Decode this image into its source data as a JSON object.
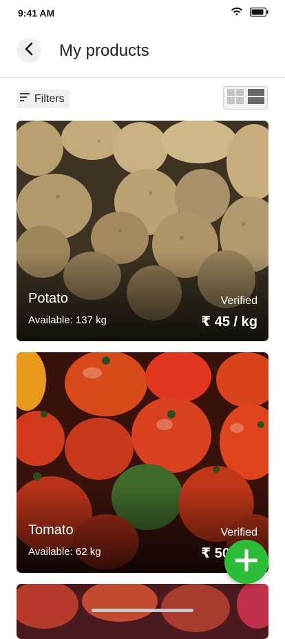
{
  "status_bar": {
    "time": "9:41 AM"
  },
  "header": {
    "title": "My products"
  },
  "toolbar": {
    "filters_label": "Filters"
  },
  "products": [
    {
      "name": "Potato",
      "available": "Available: 137 kg",
      "status": "Verified",
      "price": "₹ 45 / kg"
    },
    {
      "name": "Tomato",
      "available": "Available: 62 kg",
      "status": "Verified",
      "price": "₹ 50 / kg"
    }
  ],
  "colors": {
    "fab": "#2bbd35",
    "accent_text": "#ffffff"
  },
  "icons": [
    "wifi-icon",
    "battery-icon",
    "back-arrow-icon",
    "filter-icon",
    "grid-view-icon",
    "list-view-icon",
    "plus-icon"
  ]
}
